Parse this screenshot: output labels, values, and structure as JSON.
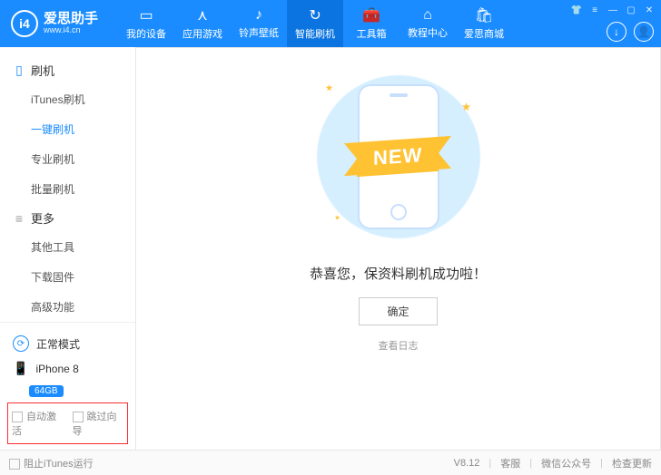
{
  "header": {
    "logo_glyph": "i4",
    "logo_title": "爱思助手",
    "logo_sub": "www.i4.cn",
    "nav": [
      {
        "icon": "▭",
        "label": "我的设备"
      },
      {
        "icon": "⋏",
        "label": "应用游戏"
      },
      {
        "icon": "♪",
        "label": "铃声壁纸"
      },
      {
        "icon": "↻",
        "label": "智能刷机"
      },
      {
        "icon": "🧰",
        "label": "工具箱"
      },
      {
        "icon": "⌂",
        "label": "教程中心"
      },
      {
        "icon": "🛍",
        "label": "爱思商城"
      }
    ],
    "nav_active_index": 3
  },
  "sidebar": {
    "group1_label": "刷机",
    "group1_items": [
      "iTunes刷机",
      "一键刷机",
      "专业刷机",
      "批量刷机"
    ],
    "group1_active_index": 1,
    "group2_label": "更多",
    "group2_items": [
      "其他工具",
      "下载固件",
      "高级功能"
    ],
    "mode_label": "正常模式",
    "device_name": "iPhone 8",
    "storage": "64GB",
    "checkbox1": "自动激活",
    "checkbox2": "跳过向导"
  },
  "main": {
    "banner_text": "NEW",
    "message": "恭喜您，保资料刷机成功啦！",
    "ok_label": "确定",
    "log_label": "查看日志"
  },
  "footer": {
    "block_itunes": "阻止iTunes运行",
    "version": "V8.12",
    "kefu": "客服",
    "wechat": "微信公众号",
    "update": "检查更新"
  }
}
